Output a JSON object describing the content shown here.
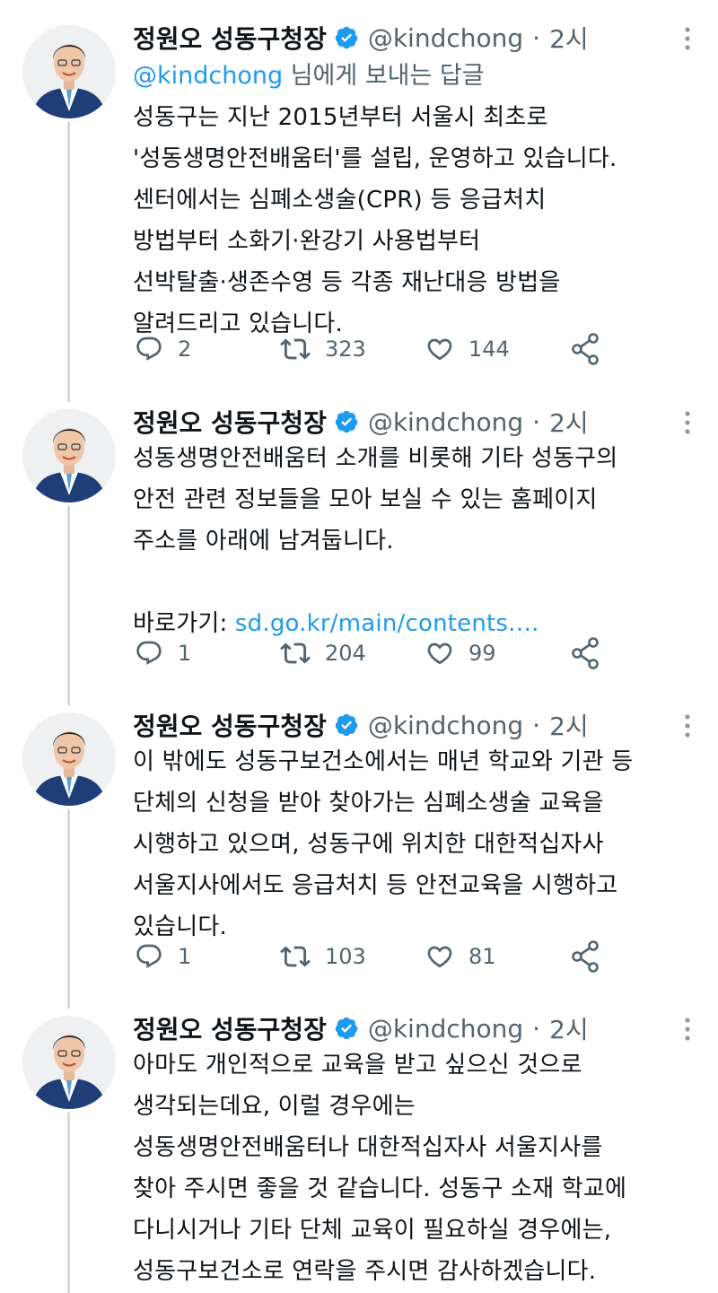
{
  "author": {
    "name": "정원오 성동구청장",
    "handle": "@kindchong",
    "verified": true
  },
  "accent_color": "#1d9bf0",
  "tweets": [
    {
      "time": "2시",
      "reply_to": {
        "mention": "@kindchong",
        "suffix": "님에게 보내는 답글"
      },
      "lines": [
        "성동구는 지난 2015년부터 서울시 최초로",
        "'성동생명안전배움터'를 설립, 운영하고 있습니다.",
        "센터에서는 심폐소생술(CPR) 등 응급처치",
        "방법부터 소화기·완강기 사용법부터",
        "선박탈출·생존수영 등 각종 재난대응 방법을",
        "알려드리고 있습니다."
      ],
      "replies": "2",
      "retweets": "323",
      "likes": "144"
    },
    {
      "time": "2시",
      "lines": [
        "성동생명안전배움터 소개를 비롯해 기타 성동구의",
        "안전 관련 정보들을 모아 보실 수 있는 홈페이지",
        "주소를 아래에 남겨둡니다."
      ],
      "link_prefix": "바로가기: ",
      "link_text": "sd.go.kr/main/contents.…",
      "replies": "1",
      "retweets": "204",
      "likes": "99"
    },
    {
      "time": "2시",
      "lines": [
        "이 밖에도 성동구보건소에서는 매년 학교와 기관 등",
        "단체의 신청을 받아 찾아가는 심폐소생술 교육을",
        "시행하고 있으며, 성동구에 위치한 대한적십자사",
        "서울지사에서도 응급처치 등 안전교육을 시행하고",
        "있습니다."
      ],
      "replies": "1",
      "retweets": "103",
      "likes": "81"
    },
    {
      "time": "2시",
      "lines": [
        "아마도 개인적으로 교육을 받고 싶으신 것으로",
        "생각되는데요, 이럴 경우에는",
        "성동생명안전배움터나 대한적십자사 서울지사를",
        "찾아 주시면 좋을 것 같습니다. 성동구 소재 학교에",
        "다니시거나 기타 단체 교육이 필요하실 경우에는,",
        "성동구보건소로 연락을 주시면 감사하겠습니다."
      ]
    }
  ]
}
